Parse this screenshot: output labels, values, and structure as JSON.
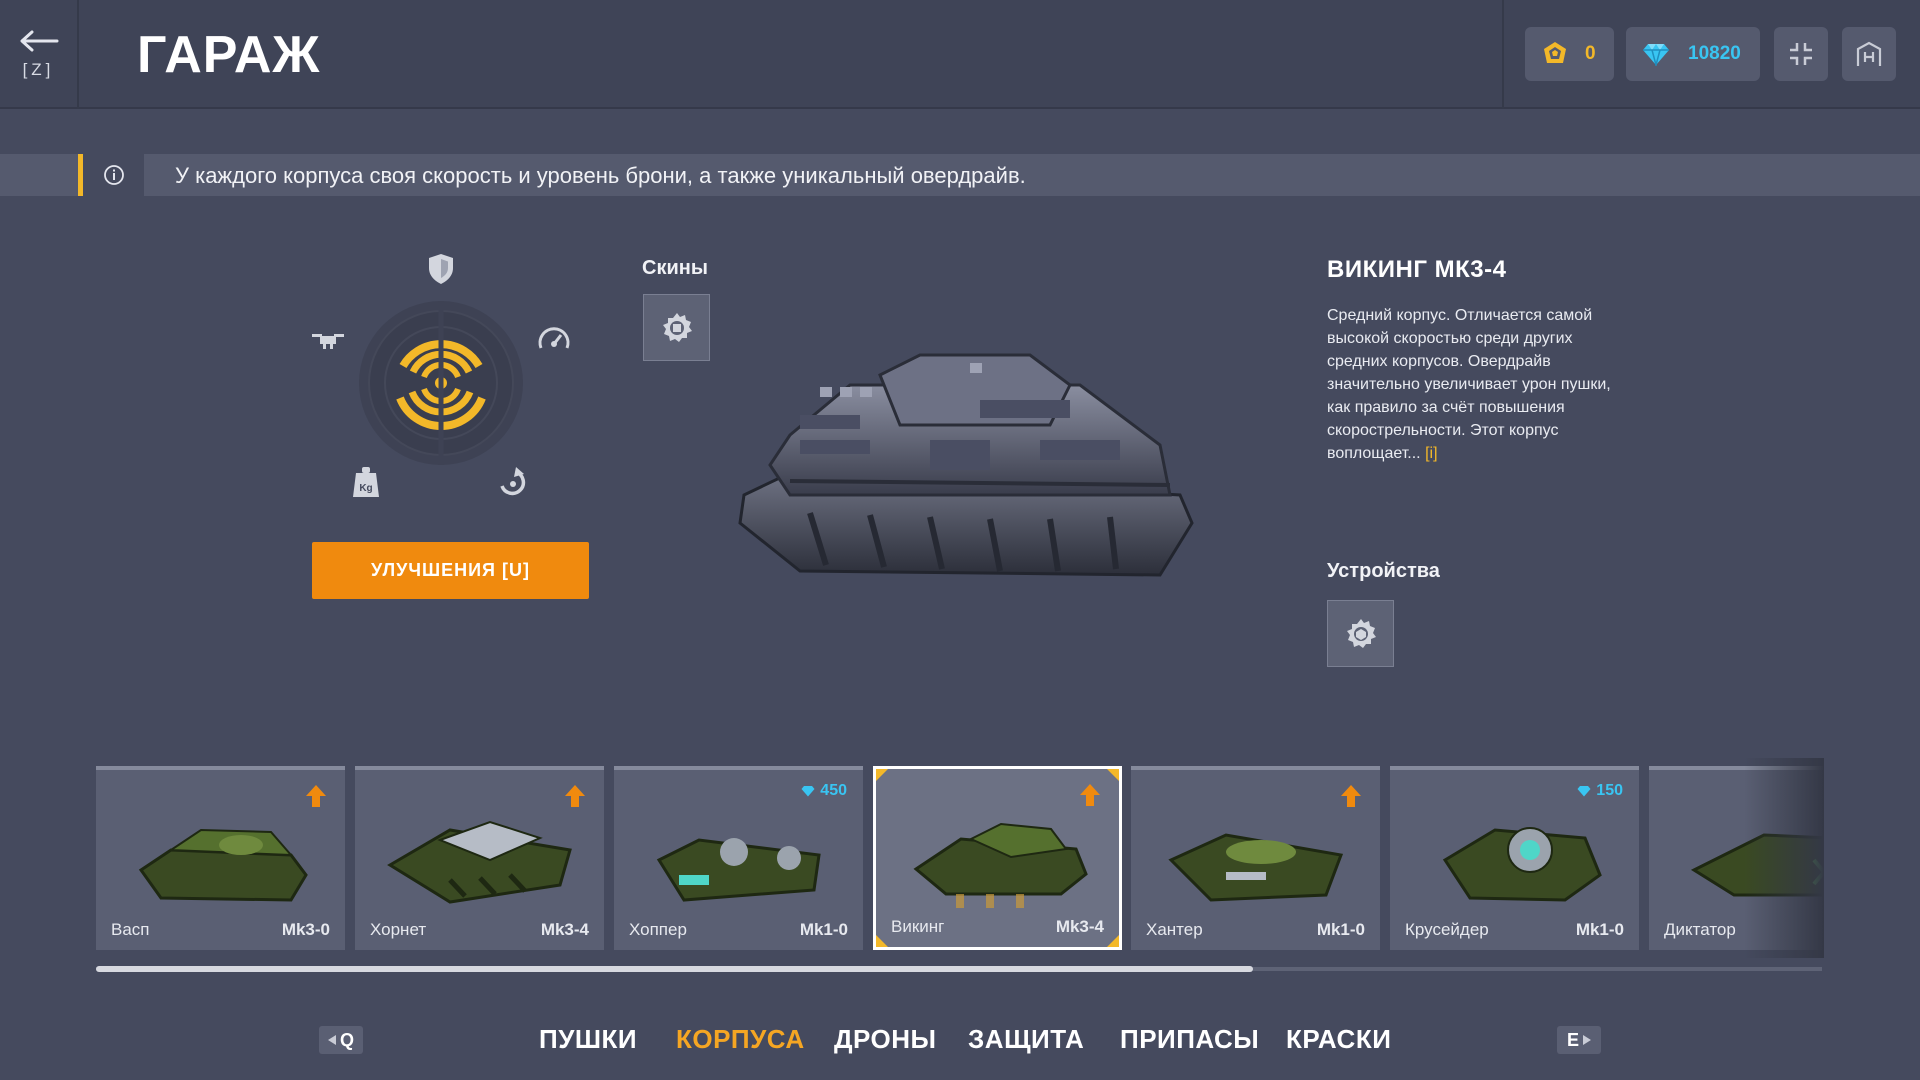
{
  "header": {
    "back_key": "[Z]",
    "title": "ГАРАЖ",
    "crystals": "0",
    "diamonds": "10820",
    "crystals_icon": "crystal-coin-icon",
    "diamonds_icon": "diamond-icon",
    "fullscreen_icon": "exit-fullscreen-icon",
    "hq_icon": "headquarters-icon"
  },
  "banner": {
    "text": "У каждого корпуса своя скорость и уровень брони, а также уникальный овердрайв.",
    "icon": "info-icon",
    "accent_color": "#f3b829"
  },
  "stats": {
    "icons": [
      "armor-shield-icon",
      "speed-gauge-icon",
      "turn-speed-icon",
      "weight-kg-icon",
      "drone-icon"
    ],
    "accent_color": "#f3b829"
  },
  "upgrade_button": "УЛУЧШЕНИЯ [U]",
  "skins": {
    "label": "Скины"
  },
  "item": {
    "name": "ВИКИНГ МК3-4",
    "description": "Средний корпус. Отличается самой высокой скоростью среди других средних корпусов. Овердрайв значительно увеличивает урон пушки, как правило за счёт повышения скорострельности. Этот корпус воплощает...",
    "more_link": "[i]"
  },
  "devices": {
    "label": "Устройства"
  },
  "carousel": {
    "items": [
      {
        "name": "Васп",
        "level": "Mk3-0",
        "badge": "upgrade-arrow"
      },
      {
        "name": "Хорнет",
        "level": "Mk3-4",
        "badge": "upgrade-arrow"
      },
      {
        "name": "Хоппер",
        "level": "Mk1-0",
        "price": "450"
      },
      {
        "name": "Викинг",
        "level": "Mk3-4",
        "badge": "upgrade-arrow",
        "selected": true
      },
      {
        "name": "Хантер",
        "level": "Mk1-0",
        "badge": "upgrade-arrow"
      },
      {
        "name": "Крусейдер",
        "level": "Mk1-0",
        "price": "150"
      },
      {
        "name": "Диктатор",
        "level": ""
      }
    ],
    "upgrade_color": "#f08a0e",
    "price_color": "#39c5f2"
  },
  "tabs": {
    "prev_key": "Q",
    "next_key": "E",
    "items": [
      {
        "label": "ПУШКИ",
        "active": false
      },
      {
        "label": "КОРПУСА",
        "active": true
      },
      {
        "label": "ДРОНЫ",
        "active": false
      },
      {
        "label": "ЗАЩИТА",
        "active": false
      },
      {
        "label": "ПРИПАСЫ",
        "active": false
      },
      {
        "label": "КРАСКИ",
        "active": false
      }
    ],
    "active_color": "#f5a623"
  }
}
